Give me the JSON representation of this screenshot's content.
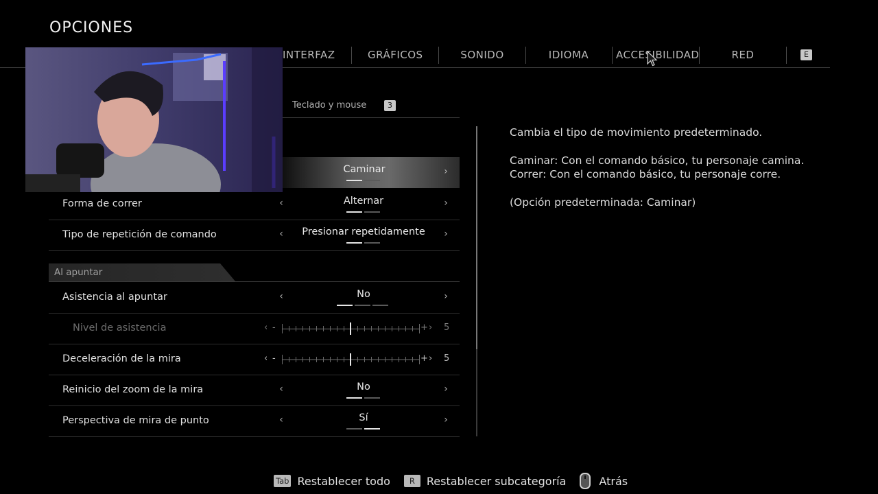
{
  "header": {
    "title": "OPCIONES"
  },
  "tabs": [
    {
      "label": "INTERFAZ"
    },
    {
      "label": "GRÁFICOS"
    },
    {
      "label": "SONIDO"
    },
    {
      "label": "IDIOMA"
    },
    {
      "label": "ACCESIBILIDAD"
    },
    {
      "label": "RED"
    }
  ],
  "tabs_next_key": "E",
  "subtab": {
    "label": "Teclado y mouse",
    "key": "3"
  },
  "settings": {
    "movement_type": {
      "value": "Caminar",
      "options_count": 2,
      "selected_index": 0
    },
    "run_mode": {
      "label": "Forma de correr",
      "value": "Alternar",
      "options_count": 2,
      "selected_index": 0
    },
    "command_repeat": {
      "label": "Tipo de repetición de comando",
      "value": "Presionar repetidamente",
      "options_count": 2,
      "selected_index": 0
    },
    "section_aiming": "Al apuntar",
    "aim_assist": {
      "label": "Asistencia al apuntar",
      "value": "No",
      "options_count": 3,
      "selected_index": 0
    },
    "assist_level": {
      "label": "Nivel de asistencia",
      "value": "5",
      "min_sym": "-",
      "max_sym": "+",
      "level": 0.5,
      "enabled": false
    },
    "aim_deceleration": {
      "label": "Deceleración de la mira",
      "value": "5",
      "min_sym": "-",
      "max_sym": "+",
      "level": 0.5
    },
    "zoom_reset": {
      "label": "Reinicio del zoom de la mira",
      "value": "No",
      "options_count": 2,
      "selected_index": 0
    },
    "dot_perspective": {
      "label": "Perspectiva de mira de punto",
      "value": "Sí",
      "options_count": 2,
      "selected_index": 1
    }
  },
  "description": {
    "line1": "Cambia el tipo de movimiento predeterminado.",
    "line2": "Caminar: Con el comando básico, tu personaje camina.",
    "line3": "Correr: Con el comando básico, tu personaje corre.",
    "line4": "(Opción predeterminada: Caminar)"
  },
  "footer": {
    "reset_all": {
      "key": "Tab",
      "label": "Restablecer todo"
    },
    "reset_sub": {
      "key": "R",
      "label": "Restablecer subcategoría"
    },
    "back": {
      "label": "Atrás"
    }
  },
  "colors": {
    "accent_selected": "#6a6a6a",
    "background": "#000000",
    "text": "#e0e0e0"
  }
}
